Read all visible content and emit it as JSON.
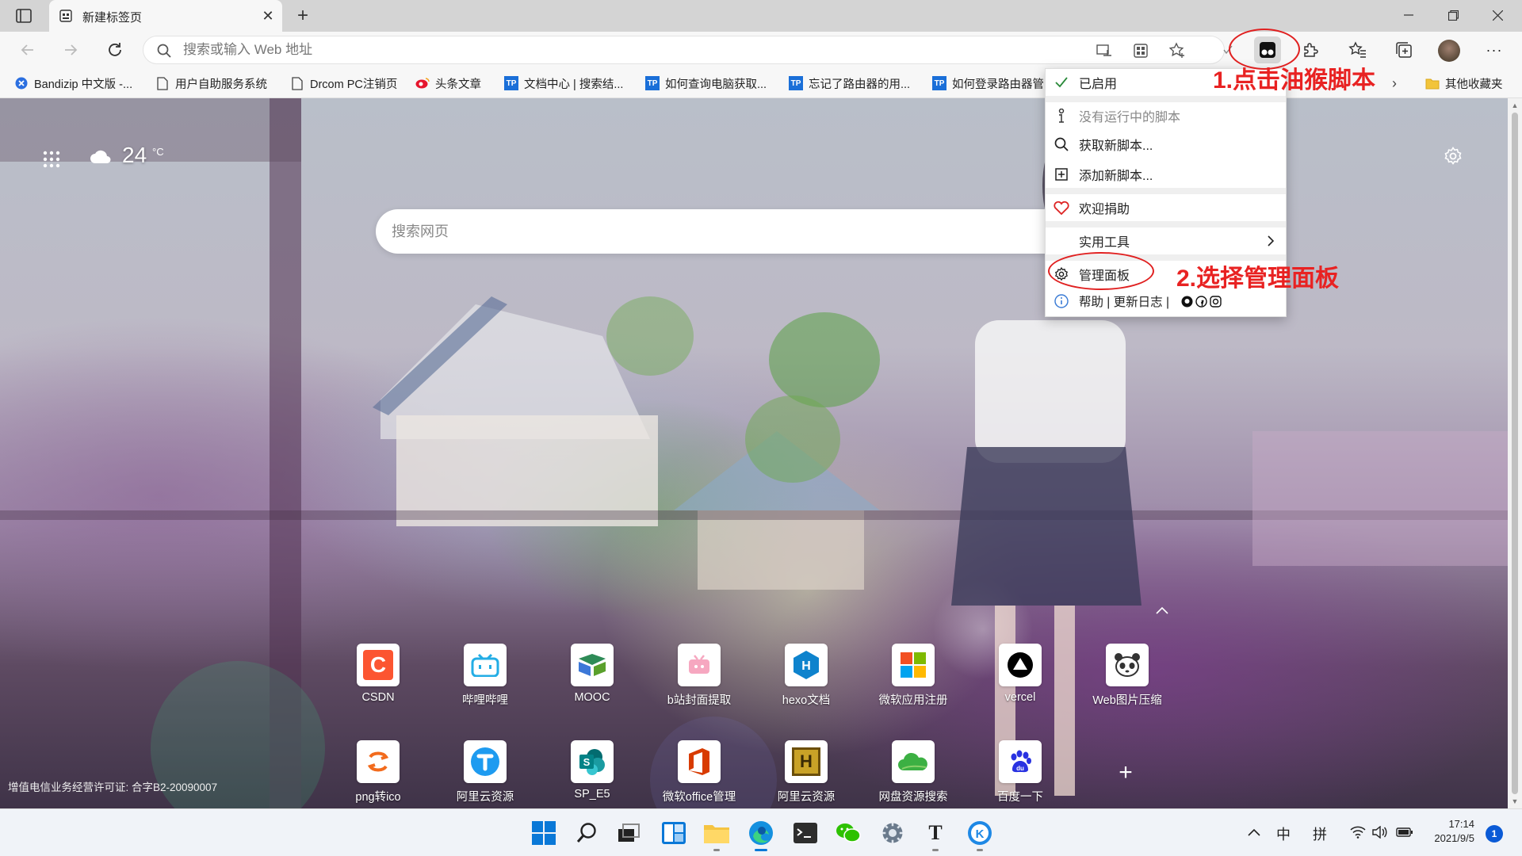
{
  "tab": {
    "title": "新建标签页"
  },
  "address_bar": {
    "placeholder": "搜索或输入 Web 地址"
  },
  "bookmarks": [
    {
      "label": "Bandizip 中文版 -...",
      "icon": "bandizip-icon",
      "color": "#2b6fe0"
    },
    {
      "label": "用户自助服务系统",
      "icon": "page-icon",
      "color": "#444444"
    },
    {
      "label": "Drcom PC注销页",
      "icon": "page-icon",
      "color": "#444444"
    },
    {
      "label": "头条文章",
      "icon": "weibo-icon",
      "color": "#e6162d"
    },
    {
      "label": "文档中心 | 搜索结...",
      "icon": "tplink-icon",
      "color": "#1a6fd8"
    },
    {
      "label": "如何查询电脑获取...",
      "icon": "tplink-icon",
      "color": "#1a6fd8"
    },
    {
      "label": "忘记了路由器的用...",
      "icon": "tplink-icon",
      "color": "#1a6fd8"
    },
    {
      "label": "如何登录路由器管",
      "icon": "tplink-icon",
      "color": "#1a6fd8"
    },
    {
      "label": "其他收藏夹",
      "icon": "folder-icon",
      "color": "#f2c43a"
    }
  ],
  "weather": {
    "temp": "24",
    "unit": "°C"
  },
  "page_search": {
    "placeholder": "搜索网页"
  },
  "menu": {
    "enabled": "已启用",
    "no_scripts": "没有运行中的脚本",
    "get_scripts": "获取新脚本...",
    "add_script": "添加新脚本...",
    "donate": "欢迎捐助",
    "tools": "实用工具",
    "dashboard": "管理面板",
    "help_line": "帮助 | 更新日志 |"
  },
  "annotations": {
    "step1": "1.点击油猴脚本",
    "step2": "2.选择管理面板",
    "color": "#e82222"
  },
  "tiles_row1": [
    {
      "label": "CSDN",
      "icon": "csdn-icon",
      "color": "#fc5531"
    },
    {
      "label": "哔哩哔哩",
      "icon": "bilibili-icon",
      "color": "#23ade5"
    },
    {
      "label": "MOOC",
      "icon": "mooc-icon",
      "color": "#2e8b57"
    },
    {
      "label": "b站封面提取",
      "icon": "bilibili-cover-icon",
      "color": "#f6a7c0"
    },
    {
      "label": "hexo文档",
      "icon": "hexo-icon",
      "color": "#0e83cd"
    },
    {
      "label": "微软应用注册",
      "icon": "microsoft-icon",
      "color": "#f25022"
    },
    {
      "label": "vercel",
      "icon": "vercel-icon",
      "color": "#000000"
    },
    {
      "label": "Web图片压缩",
      "icon": "tinypng-icon",
      "color": "#333333"
    }
  ],
  "tiles_row2": [
    {
      "label": "png转ico",
      "icon": "png-ico-icon",
      "color": "#f26b1d"
    },
    {
      "label": "阿里云资源",
      "icon": "aliyun-drive-icon",
      "color": "#1e9bf0"
    },
    {
      "label": "SP_E5",
      "icon": "sharepoint-icon",
      "color": "#038387"
    },
    {
      "label": "微软office管理",
      "icon": "office-icon",
      "color": "#d83b01"
    },
    {
      "label": "阿里云资源",
      "icon": "h-icon",
      "color": "#8b6914"
    },
    {
      "label": "网盘资源搜索",
      "icon": "cloud-search-icon",
      "color": "#3cb043"
    },
    {
      "label": "百度一下",
      "icon": "baidu-icon",
      "color": "#2932e1"
    }
  ],
  "license": "增值电信业务经营许可证: 合字B2-20090007",
  "tray": {
    "input_zh": "中",
    "input_py": "拼"
  },
  "clock": {
    "time": "17:14",
    "date": "2021/9/5"
  },
  "notifications": "1"
}
